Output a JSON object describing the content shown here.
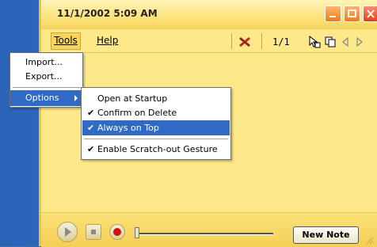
{
  "window": {
    "title": "11/1/2002 5:09 AM"
  },
  "menubar": {
    "tools": "Tools",
    "help": "Help",
    "page_count": "1/1"
  },
  "tools_menu": {
    "items": [
      {
        "label": "Import..."
      },
      {
        "label": "Export..."
      },
      {
        "label": "Options"
      }
    ]
  },
  "options_submenu": {
    "items": [
      {
        "label": "Open at Startup",
        "checked": false
      },
      {
        "label": "Confirm on Delete",
        "checked": true
      },
      {
        "label": "Always on Top",
        "checked": true
      },
      {
        "label": "Enable Scratch-out Gesture",
        "checked": true
      }
    ]
  },
  "bottom": {
    "new_note": "New Note"
  },
  "icons": [
    "delete-icon",
    "cursor-copy-icon",
    "copy-icon",
    "prev-icon",
    "next-icon",
    "play-icon",
    "stop-icon",
    "record-icon"
  ],
  "colors": {
    "note": "#fde98a",
    "selection": "#316ac5",
    "desktop": "#3c7fd4"
  }
}
